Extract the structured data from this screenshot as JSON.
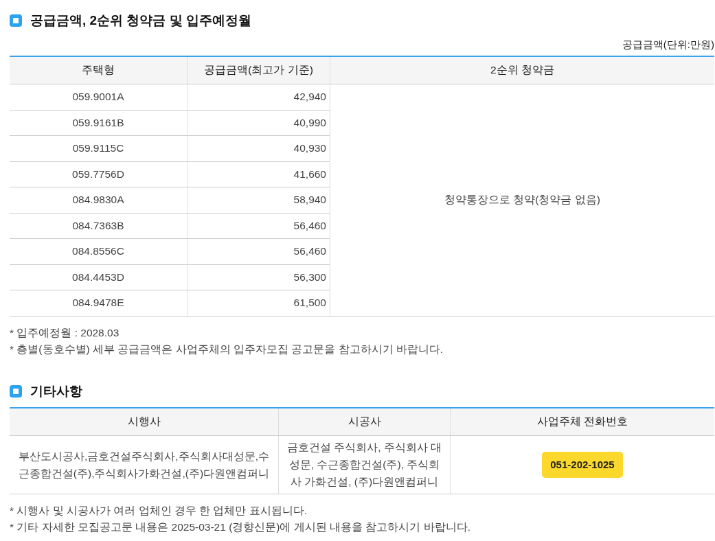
{
  "supply_section": {
    "title": "공급금액, 2순위 청약금 및 입주예정월",
    "unit_label": "공급금액(단위:만원)",
    "columns": [
      "주택형",
      "공급금액(최고가 기준)",
      "2순위 청약금"
    ],
    "rows": [
      {
        "type": "059.9001A",
        "price": "42,940"
      },
      {
        "type": "059.9161B",
        "price": "40,990"
      },
      {
        "type": "059.9115C",
        "price": "40,930"
      },
      {
        "type": "059.7756D",
        "price": "41,660"
      },
      {
        "type": "084.9830A",
        "price": "58,940"
      },
      {
        "type": "084.7363B",
        "price": "56,460"
      },
      {
        "type": "084.8556C",
        "price": "56,460"
      },
      {
        "type": "084.4453D",
        "price": "56,300"
      },
      {
        "type": "084.9478E",
        "price": "61,500"
      }
    ],
    "deposit_note": "청약통장으로 청약(청약금 없음)",
    "notes": [
      "* 입주예정월 : 2028.03",
      "* 층별(동호수별) 세부 공급금액은 사업주체의 입주자모집 공고문을 참고하시기 바랍니다."
    ]
  },
  "etc_section": {
    "title": "기타사항",
    "columns": [
      "시행사",
      "시공사",
      "사업주체 전화번호"
    ],
    "developer": "부산도시공사,금호건설주식회사,주식회사대성문,수근종합건설(주),주식회사가화건설,(주)다원앤컴퍼니",
    "builder": "금호건설 주식회사, 주식회사 대성문, 수근종합건설(주), 주식회사 가화건설, (주)다원앤컴퍼니",
    "phone": "051-202-1025",
    "notes": [
      "* 시행사 및 시공사가 여러 업체인 경우 한 업체만 표시됩니다.",
      "* 기타 자세한 모집공고문 내용은 2025-03-21 (경향신문)에 게시된 내용을 참고하시기 바랍니다."
    ]
  }
}
